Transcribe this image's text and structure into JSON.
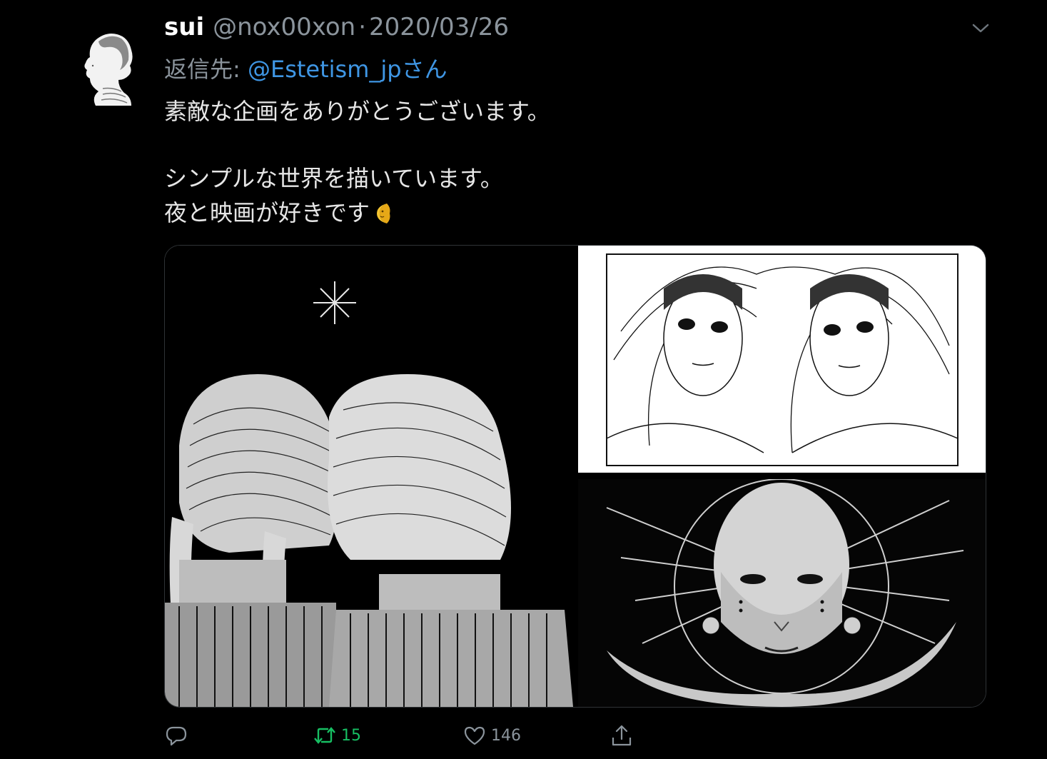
{
  "tweet": {
    "author_name": "sui",
    "author_handle": "@nox00xon",
    "separator": "·",
    "date": "2020/03/26",
    "reply_to_label": "返信先: ",
    "reply_to_handle": "@Estetism_jpさん",
    "body_lines": [
      "素敵な企画をありがとうございます。",
      "シンプルな世界を描いています。",
      "夜と映画が好きです"
    ],
    "emoji": "crescent-moon-face"
  },
  "media": {
    "count": 3,
    "images": [
      "illustration-two-girls-back-view",
      "illustration-twin-girls-faces",
      "illustration-bald-figure-halo"
    ]
  },
  "actions": {
    "reply_count": "",
    "retweet_count": "15",
    "like_count": "146"
  },
  "colors": {
    "background": "#000000",
    "link": "#3f96e4",
    "retweet_active": "#17bf63",
    "secondary_text": "#8b949c"
  }
}
